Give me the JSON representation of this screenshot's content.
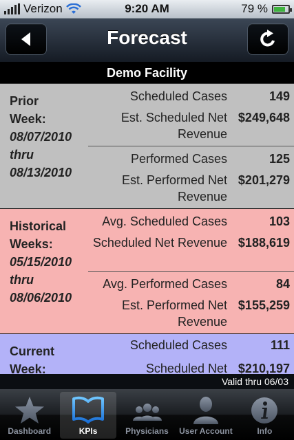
{
  "status": {
    "carrier": "Verizon",
    "time": "9:20 AM",
    "battery": "79 %",
    "battery_level": 0.79
  },
  "nav": {
    "title": "Forecast",
    "back_icon": "back-arrow-icon",
    "refresh_icon": "refresh-icon"
  },
  "facility": "Demo Facility",
  "colors": {
    "prior": "#c0c0c0",
    "historical": "#f7b3b2",
    "current": "#b3b2f8"
  },
  "sections": [
    {
      "label_lines": [
        "Prior",
        "Week:"
      ],
      "date_lines": [
        "08/07/2010",
        "thru",
        "08/13/2010"
      ],
      "rows": [
        {
          "label": "Scheduled Cases",
          "value": "149"
        },
        {
          "label": "Est. Scheduled Net Revenue",
          "value": "$249,648"
        },
        {
          "label": "Performed Cases",
          "value": "125"
        },
        {
          "label": "Est. Performed Net Revenue",
          "value": "$201,279"
        }
      ]
    },
    {
      "label_lines": [
        "Historical",
        "Weeks:"
      ],
      "date_lines": [
        "05/15/2010",
        "thru",
        "08/06/2010"
      ],
      "rows": [
        {
          "label": "Avg. Scheduled Cases",
          "value": "103"
        },
        {
          "label": "Scheduled Net Revenue",
          "value": "$188,619"
        },
        {
          "label": "Avg. Performed Cases",
          "value": "84"
        },
        {
          "label": "Est. Performed Net Revenue",
          "value": "$155,259"
        }
      ]
    },
    {
      "label_lines": [
        "Current",
        "Week:"
      ],
      "date_lines": [],
      "rows": [
        {
          "label": "Scheduled Cases",
          "value": "111"
        },
        {
          "label": "Scheduled Net",
          "value": "$210,197"
        }
      ]
    }
  ],
  "valid_thru": "Valid thru 06/03",
  "tabs": [
    {
      "label": "Dashboard",
      "icon": "star-icon",
      "active": false
    },
    {
      "label": "KPIs",
      "icon": "book-icon",
      "active": true
    },
    {
      "label": "Physicians",
      "icon": "group-icon",
      "active": false
    },
    {
      "label": "User Account",
      "icon": "person-icon",
      "active": false
    },
    {
      "label": "Info",
      "icon": "info-icon",
      "active": false
    }
  ]
}
